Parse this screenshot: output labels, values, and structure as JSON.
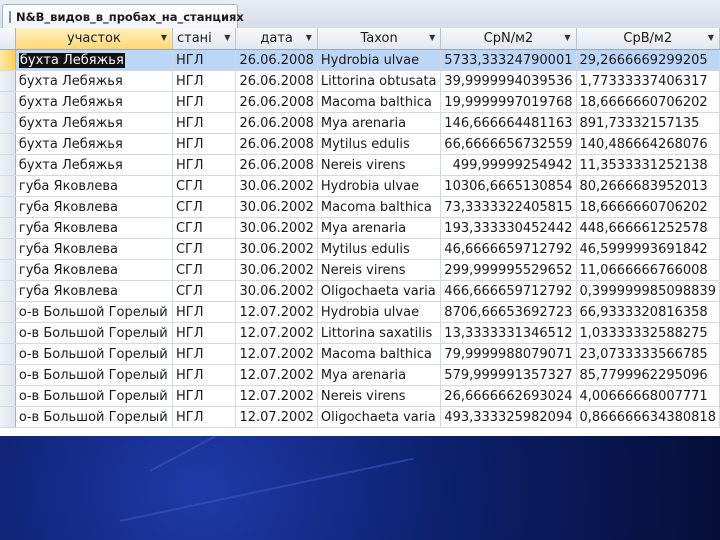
{
  "tab": {
    "title": "N&B_видов_в_пробах_на_станциях"
  },
  "columns": [
    {
      "label": "участок"
    },
    {
      "label": "стані"
    },
    {
      "label": "дата"
    },
    {
      "label": "Taxon"
    },
    {
      "label": "CpN/м2"
    },
    {
      "label": "CpB/м2"
    }
  ],
  "rows": [
    [
      "бухта Лебяжья",
      "НГЛ",
      "26.06.2008",
      "Hydrobia ulvae",
      "5733,33324790001",
      "29,2666669299205"
    ],
    [
      "бухта Лебяжья",
      "НГЛ",
      "26.06.2008",
      "Littorina obtusata",
      "39,9999994039536",
      "1,77333337406317"
    ],
    [
      "бухта Лебяжья",
      "НГЛ",
      "26.06.2008",
      "Macoma balthica",
      "19,9999997019768",
      "18,6666660706202"
    ],
    [
      "бухта Лебяжья",
      "НГЛ",
      "26.06.2008",
      "Mya arenaria",
      "146,666664481163",
      "891,73332157135"
    ],
    [
      "бухта Лебяжья",
      "НГЛ",
      "26.06.2008",
      "Mytilus edulis",
      "66,6666656732559",
      "140,486664268076"
    ],
    [
      "бухта Лебяжья",
      "НГЛ",
      "26.06.2008",
      "Nereis virens",
      "499,99999254942",
      "11,3533331252138"
    ],
    [
      "губа Яковлева",
      "СГЛ",
      "30.06.2002",
      "Hydrobia ulvae",
      "10306,6665130854",
      "80,2666683952013"
    ],
    [
      "губа Яковлева",
      "СГЛ",
      "30.06.2002",
      "Macoma balthica",
      "73,3333322405815",
      "18,6666660706202"
    ],
    [
      "губа Яковлева",
      "СГЛ",
      "30.06.2002",
      "Mya arenaria",
      "193,333330452442",
      "448,666661252578"
    ],
    [
      "губа Яковлева",
      "СГЛ",
      "30.06.2002",
      "Mytilus edulis",
      "46,6666659712792",
      "46,5999993691842"
    ],
    [
      "губа Яковлева",
      "СГЛ",
      "30.06.2002",
      "Nereis virens",
      "299,999995529652",
      "11,0666666766008"
    ],
    [
      "губа Яковлева",
      "СГЛ",
      "30.06.2002",
      "Oligochaeta varia",
      "466,666659712792",
      "0,399999985098839"
    ],
    [
      "о-в Большой Горелый",
      "НГЛ",
      "12.07.2002",
      "Hydrobia ulvae",
      "8706,66653692723",
      "66,9333320816358"
    ],
    [
      "о-в Большой Горелый",
      "НГЛ",
      "12.07.2002",
      "Littorina saxatilis",
      "13,3333331346512",
      "1,03333332588275"
    ],
    [
      "о-в Большой Горелый",
      "НГЛ",
      "12.07.2002",
      "Macoma balthica",
      "79,9999988079071",
      "23,0733333566785"
    ],
    [
      "о-в Большой Горелый",
      "НГЛ",
      "12.07.2002",
      "Mya arenaria",
      "579,999991357327",
      "85,7799962295096"
    ],
    [
      "о-в Большой Горелый",
      "НГЛ",
      "12.07.2002",
      "Nereis virens",
      "26,6666662693024",
      "4,00666668007771"
    ],
    [
      "о-в Большой Горелый",
      "НГЛ",
      "12.07.2002",
      "Oligochaeta varia",
      "493,333325982094",
      "0,866666634380818"
    ]
  ]
}
